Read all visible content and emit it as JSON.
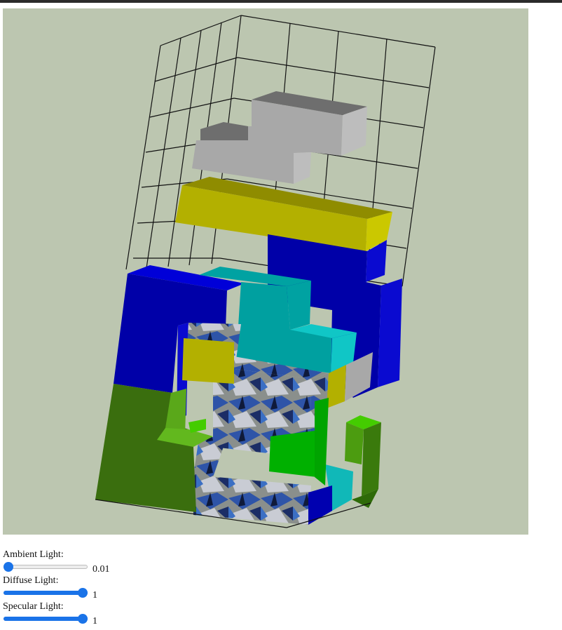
{
  "canvas": {
    "background": "#bcc6b0",
    "content": "tetris-3d-scene"
  },
  "controls": {
    "ambient": {
      "label": "Ambient Light:",
      "value": "0.01",
      "fraction": 0.0
    },
    "diffuse": {
      "label": "Diffuse Light:",
      "value": "1",
      "fraction": 1.0
    },
    "specular": {
      "label": "Specular Light:",
      "value": "1",
      "fraction": 1.0
    }
  },
  "colors": {
    "accent": "#1a73e8",
    "grid_line": "#111111",
    "block_gray": "#a9a9a9",
    "block_yellow": "#b3b000",
    "block_blue": "#0000b8",
    "block_cyan": "#00b0b0",
    "block_green": "#3f7a10",
    "block_texture": "#7d8aa8"
  }
}
